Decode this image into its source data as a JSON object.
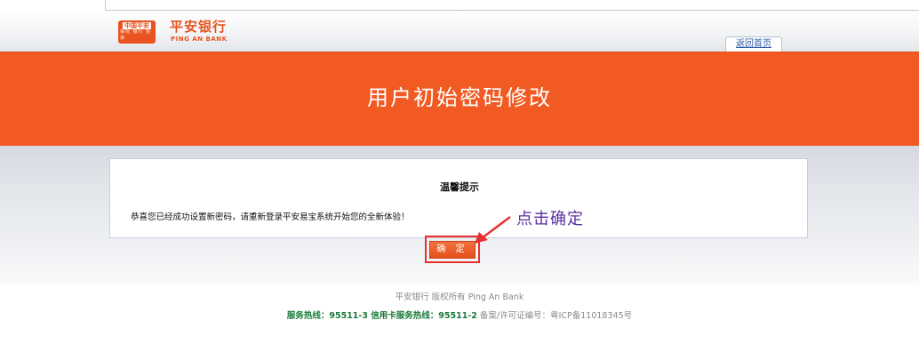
{
  "header": {
    "logo_text_top": "中国平安",
    "logo_text_bottom": "保险 银行 投资",
    "bank_name": "平安银行",
    "bank_name_en": "PING AN BANK",
    "home_link": "返回首页"
  },
  "banner": {
    "title": "用户初始密码修改"
  },
  "panel": {
    "title": "温馨提示",
    "message": "恭喜您已经成功设置新密码，请重新登录平安易宝系统开始您的全新体验！"
  },
  "annotation": {
    "text": "点击确定",
    "color": "#5a2ea0",
    "highlight_color": "#e83030"
  },
  "confirm_button": {
    "label": "确 定"
  },
  "footer": {
    "copyright": "平安银行  版权所有  Ping An Bank",
    "hotline_label": "服务热线：95511-3 信用卡服务热线：95511-2",
    "license": "  备案/许可证编号：粤ICP备11018345号"
  },
  "colors": {
    "brand_orange": "#f15a22",
    "footer_green": "#1a7a3a"
  }
}
